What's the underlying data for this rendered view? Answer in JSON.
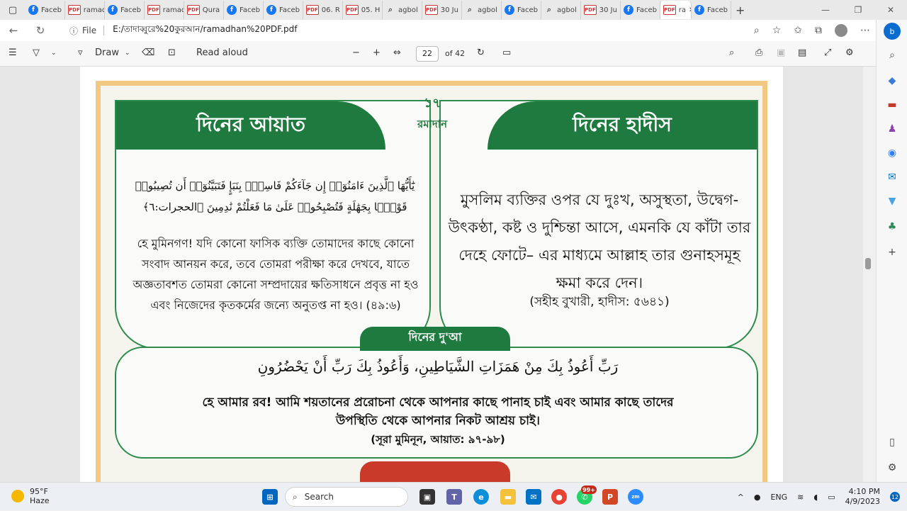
{
  "tabs": [
    {
      "label": "Faceb",
      "kind": "fb",
      "active": false
    },
    {
      "label": "ramad",
      "kind": "pdf",
      "active": false
    },
    {
      "label": "Faceb",
      "kind": "fb",
      "active": false
    },
    {
      "label": "ramad",
      "kind": "pdf",
      "active": false
    },
    {
      "label": "Qura",
      "kind": "pdf",
      "active": false
    },
    {
      "label": "Faceb",
      "kind": "fb",
      "active": false
    },
    {
      "label": "Faceb",
      "kind": "fb",
      "active": false
    },
    {
      "label": "06. R",
      "kind": "pdf",
      "active": false
    },
    {
      "label": "05. H",
      "kind": "pdf",
      "active": false
    },
    {
      "label": "agbol",
      "kind": "srch",
      "active": false
    },
    {
      "label": "30 Ju",
      "kind": "pdf",
      "active": false
    },
    {
      "label": "agbol",
      "kind": "srch",
      "active": false
    },
    {
      "label": "Faceb",
      "kind": "fb",
      "active": false
    },
    {
      "label": "agbol",
      "kind": "srch",
      "active": false
    },
    {
      "label": "30 Ju",
      "kind": "pdf",
      "active": false
    },
    {
      "label": "Faceb",
      "kind": "fb",
      "active": false
    },
    {
      "label": "ra",
      "kind": "pdf",
      "active": true
    },
    {
      "label": "Faceb",
      "kind": "fb",
      "active": false
    }
  ],
  "address": {
    "info": "ⓘ",
    "file_label": "File",
    "url": "E:/তাদাব্বুরে%20কুরআন/ramadhan%20PDF.pdf"
  },
  "pdf_toolbar": {
    "draw": "Draw",
    "read_aloud": "Read aloud",
    "page_current": "22",
    "page_total": "of 42"
  },
  "page": {
    "day_number": "১৭",
    "day_name": "রমাদান",
    "left_header": "দিনের আয়াত",
    "right_header": "দিনের হাদীস",
    "ayat_arabic": "يَٰٓأَيُّهَا ٱلَّذِينَ ءَامَنُوٓا۟ إِن جَآءَكُمْ فَاسِقٌۢ بِنَبَإٍ فَتَبَيَّنُوٓا۟ أَن تُصِيبُوا۟ قَوْمًۢا بِجَهَٰلَةٍ فَتُصْبِحُوا۟ عَلَىٰ مَا فَعَلْتُمْ نَٰدِمِينَ ﴿الحجرات:٦﴾",
    "ayat_bangla": "হে মুমিনগণ! যদি কোনো ফাসিক ব্যক্তি তোমাদের কাছে কোনো সংবাদ আনয়ন করে, তবে তোমরা পরীক্ষা করে দেখবে, যাতে অজ্ঞতাবশত তোমরা কোনো সম্প্রদায়ের ক্ষতিসাধনে প্রবৃত্ত না হও এবং নিজেদের কৃতকর্মের জন্যে অনুতপ্ত না হও। (৪৯:৬)",
    "hadith_bangla": "মুসলিম ব্যক্তির ওপর যে দুঃখ, অসুস্থতা, উদ্বেগ-উৎকণ্ঠা, কষ্ট ও দুশ্চিন্তা আসে, এমনকি যে কাঁটা তার দেহে ফোটে– এর মাধ্যমে আল্লাহ তার গুনাহসমূহ ক্ষমা করে দেন।",
    "hadith_ref": "(সহীহ বুখারী, হাদীস: ৫৬৪১)",
    "dua_title": "দিনের দু'আ",
    "dua_arabic": "رَبِّ أَعُوذُ بِكَ مِنْ هَمَزَاتِ الشَّيَاطِينِ، وَأَعُوذُ بِكَ رَبِّ أَنْ يَحْضُرُونِ",
    "dua_bangla": "হে আমার রব! আমি শয়তানের প্ররোচনা থেকে আপনার কাছে পানাহ চাই এবং আমার কাছে তাদের উপস্থিতি থেকে আপনার নিকট আশ্রয় চাই।",
    "dua_ref": "(সূরা মুমিনূন, আয়াত: ৯৭-৯৮)"
  },
  "taskbar": {
    "temp": "95°F",
    "condition": "Haze",
    "search": "Search",
    "badge": "99+",
    "lang": "ENG",
    "time": "4:10 PM",
    "date": "4/9/2023",
    "notif": "12"
  },
  "colors": {
    "header_green": "#1e7a3e",
    "frame_orange": "#f2c882",
    "next_red": "#c93a2a"
  }
}
